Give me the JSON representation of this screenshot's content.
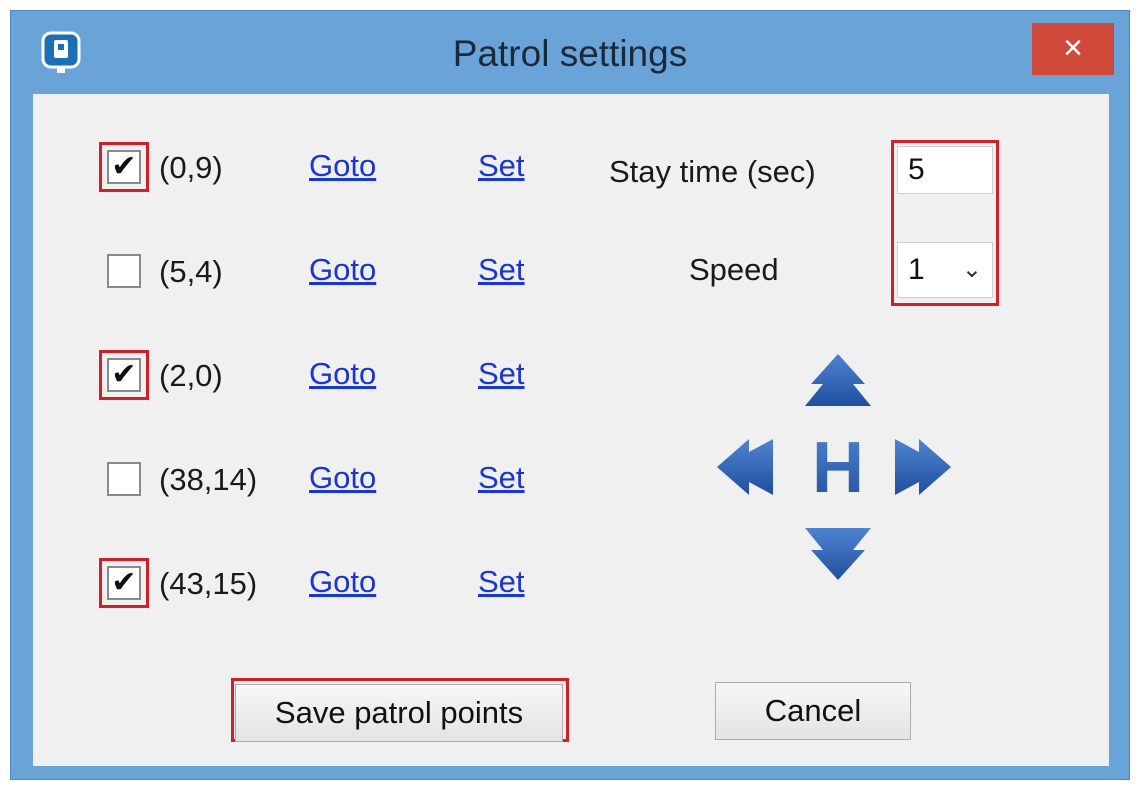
{
  "window": {
    "title": "Patrol settings",
    "close_label": "×"
  },
  "points": [
    {
      "coord": "(0,9)",
      "checked": true,
      "highlighted": true,
      "goto": "Goto",
      "set": "Set"
    },
    {
      "coord": "(5,4)",
      "checked": false,
      "highlighted": false,
      "goto": "Goto",
      "set": "Set"
    },
    {
      "coord": "(2,0)",
      "checked": true,
      "highlighted": true,
      "goto": "Goto",
      "set": "Set"
    },
    {
      "coord": "(38,14)",
      "checked": false,
      "highlighted": false,
      "goto": "Goto",
      "set": "Set"
    },
    {
      "coord": "(43,15)",
      "checked": true,
      "highlighted": true,
      "goto": "Goto",
      "set": "Set"
    }
  ],
  "settings": {
    "stay_label": "Stay time (sec)",
    "stay_value": "5",
    "speed_label": "Speed",
    "speed_value": "1"
  },
  "ptz": {
    "home_label": "H",
    "color": "#2a5aa8"
  },
  "buttons": {
    "save_label": "Save patrol points",
    "cancel_label": "Cancel"
  },
  "colors": {
    "titlebar": "#6aa3d8",
    "close": "#cf4a3b",
    "highlight": "#d2202a",
    "link": "#1a35d0"
  }
}
